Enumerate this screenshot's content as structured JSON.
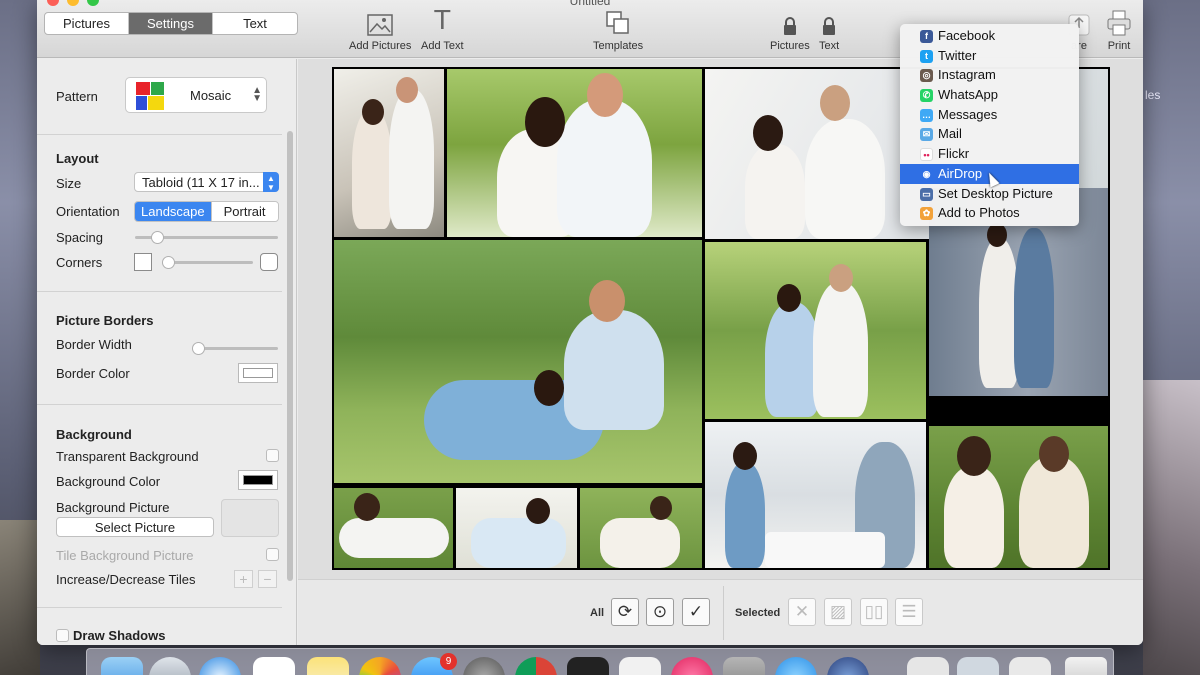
{
  "window": {
    "title": "Untitled"
  },
  "tabs": [
    {
      "label": "Pictures",
      "active": false
    },
    {
      "label": "Settings",
      "active": true
    },
    {
      "label": "Text",
      "active": false
    }
  ],
  "toolbar": {
    "add_pictures": "Add Pictures",
    "add_text": "Add Text",
    "templates": "Templates",
    "lock_pictures": "Pictures",
    "lock_text": "Text",
    "share": "are",
    "print": "Print"
  },
  "settings": {
    "pattern_label": "Pattern",
    "pattern_value": "Mosaic",
    "layout": {
      "heading": "Layout",
      "size_label": "Size",
      "size_value": "Tabloid (11 X 17 in...",
      "orientation_label": "Orientation",
      "orientation_landscape": "Landscape",
      "orientation_portrait": "Portrait",
      "spacing_label": "Spacing",
      "corners_label": "Corners",
      "spacing_level": 0.12,
      "corners_level": 0.0
    },
    "borders": {
      "heading": "Picture Borders",
      "width_label": "Border Width",
      "color_label": "Border Color",
      "width_level": 0.0
    },
    "background": {
      "heading": "Background",
      "transparent_label": "Transparent Background",
      "color_label": "Background Color",
      "picture_label": "Background Picture",
      "select_button": "Select Picture",
      "tile_label": "Tile Background Picture",
      "tiles_label": "Increase/Decrease Tiles",
      "plus": "+",
      "minus": "−"
    },
    "shadows_label": "Draw Shadows"
  },
  "bottom": {
    "all_label": "All",
    "selected_label": "Selected"
  },
  "share_menu": {
    "items": [
      {
        "label": "Facebook",
        "icon": "facebook-icon",
        "color": "#3b5998",
        "glyph": "f",
        "selected": false
      },
      {
        "label": "Twitter",
        "icon": "twitter-icon",
        "color": "#1da1f2",
        "glyph": "t",
        "selected": false
      },
      {
        "label": "Instagram",
        "icon": "instagram-icon",
        "color": "#6b5a4e",
        "glyph": "◎",
        "selected": false
      },
      {
        "label": "WhatsApp",
        "icon": "whatsapp-icon",
        "color": "#25d366",
        "glyph": "✆",
        "selected": false
      },
      {
        "label": "Messages",
        "icon": "messages-icon",
        "color": "#3fa9f5",
        "glyph": "…",
        "selected": false
      },
      {
        "label": "Mail",
        "icon": "mail-icon",
        "color": "#5aa9e6",
        "glyph": "✉",
        "selected": false
      },
      {
        "label": "Flickr",
        "icon": "flickr-icon",
        "color": "#ffffff",
        "glyph": "••",
        "selected": false
      },
      {
        "label": "AirDrop",
        "icon": "airdrop-icon",
        "color": "#2f6fe4",
        "glyph": "◉",
        "selected": true
      },
      {
        "label": "Set Desktop Picture",
        "icon": "desktop-picture-icon",
        "color": "#4a6ea8",
        "glyph": "▭",
        "selected": false
      },
      {
        "label": "Add to Photos",
        "icon": "photos-icon",
        "color": "#f2a23a",
        "glyph": "✿",
        "selected": false
      }
    ]
  },
  "dock": {
    "badge_count": "9"
  },
  "desktop": {
    "label_fragment": "les"
  }
}
